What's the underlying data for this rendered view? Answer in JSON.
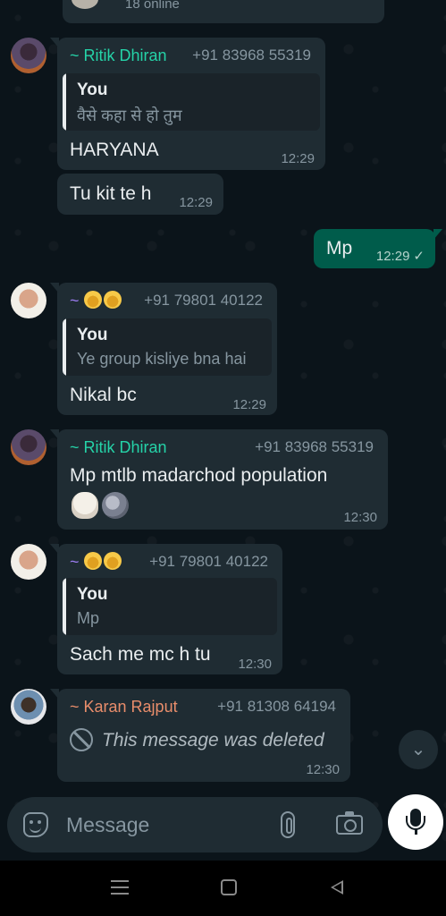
{
  "header": {
    "online_text": "18 online"
  },
  "messages": [
    {
      "sender": "~ Ritik Dhiran",
      "sender_color": "#25d3a8",
      "phone": "+91 83968 55319",
      "quote": {
        "name": "You",
        "text": "वैसे कहा से हो तुम"
      },
      "text": "HARYANA",
      "time": "12:29"
    },
    {
      "text": "Tu kit te h",
      "time": "12:29"
    },
    {
      "direction": "out",
      "text": "Mp",
      "time": "12:29",
      "status": "read-tick"
    },
    {
      "sender": "~",
      "sender_color": "#9b7cf0",
      "phone": "+91 79801 40122",
      "quote": {
        "name": "You",
        "text": "Ye group kisliye bna hai"
      },
      "text": "Nikal bc",
      "time": "12:29"
    },
    {
      "sender": "~ Ritik Dhiran",
      "sender_color": "#25d3a8",
      "phone": "+91 83968 55319",
      "text": "Mp mtlb madarchod population",
      "emojis": [
        "skull",
        "new-moon-face"
      ],
      "time": "12:30"
    },
    {
      "sender": "~",
      "sender_color": "#9b7cf0",
      "phone": "+91 79801 40122",
      "quote": {
        "name": "You",
        "text": "Mp"
      },
      "text": "Sach me mc h tu",
      "time": "12:30"
    },
    {
      "sender": "~ Karan Rajput",
      "sender_color": "#e98d6b",
      "phone": "+91 81308 64194",
      "text": "This message was deleted",
      "deleted": true,
      "time": "12:30"
    }
  ],
  "composer": {
    "placeholder": "Message"
  },
  "icons": {
    "sticker": "sticker-icon",
    "attach": "paperclip-icon",
    "camera": "camera-icon",
    "mic": "microphone-icon",
    "scroll": "double-chevron-down-icon"
  }
}
